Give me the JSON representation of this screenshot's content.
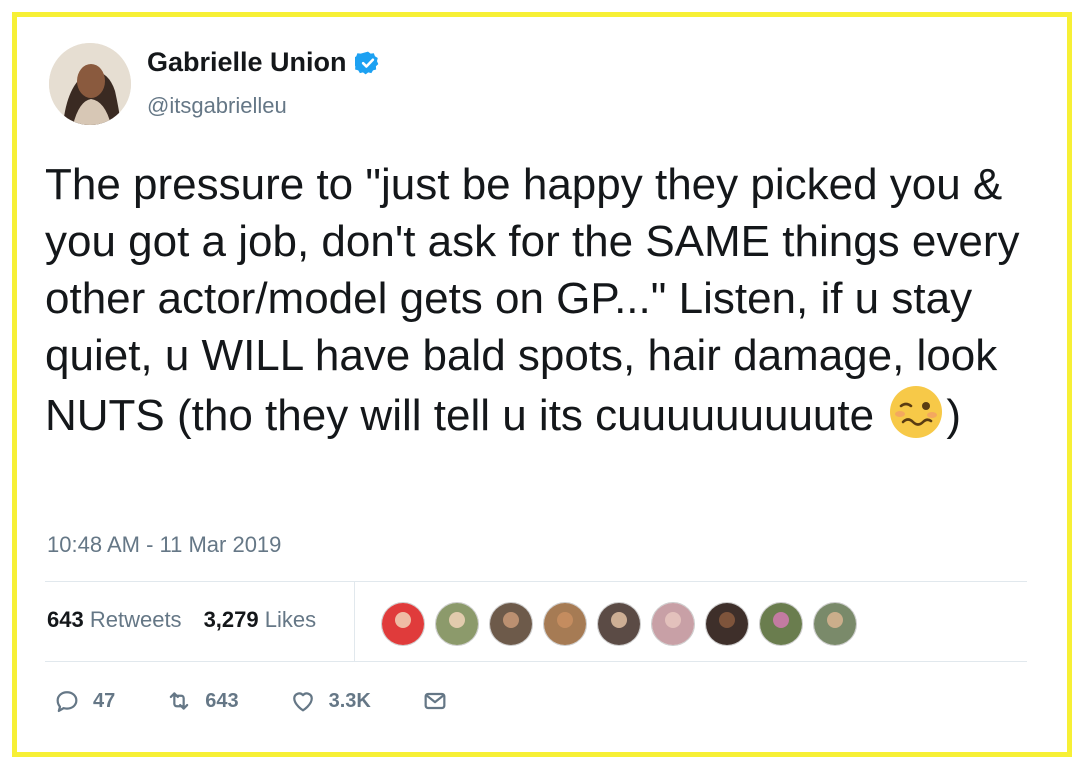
{
  "author": {
    "name": "Gabrielle Union",
    "handle": "@itsgabrielleu"
  },
  "tweet": {
    "text": "The pressure to \"just be happy they picked you & you got a job, don't ask for the SAME things every other actor/model gets on GP...\" Listen, if u stay quiet, u WILL have bald spots, hair damage, look NUTS (tho they will tell u its cuuuuuuuuute ",
    "text_end": ")",
    "emoji": "woozy-face-emoji"
  },
  "timestamp": "10:48 AM - 11 Mar 2019",
  "stats": {
    "retweets_count": "643",
    "retweets_label": "Retweets",
    "likes_count": "3,279",
    "likes_label": "Likes"
  },
  "likers": [
    "#e03b3b",
    "#8c9a6b",
    "#6d5a4a",
    "#a67b54",
    "#5b4b45",
    "#c8a0a6",
    "#3e2f2a",
    "#6a7d4e",
    "#7a8a6a"
  ],
  "actions": {
    "replies": "47",
    "retweets": "643",
    "likes": "3.3K"
  },
  "colors": {
    "frame": "#f7f035",
    "verified": "#1da1f2",
    "secondary_text": "#657786"
  }
}
